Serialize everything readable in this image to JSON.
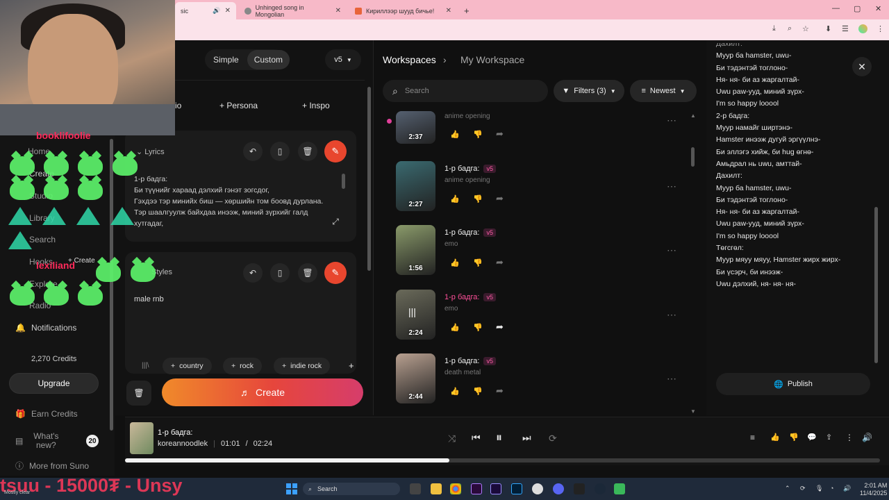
{
  "browser": {
    "tabs": [
      {
        "label": "sic",
        "active": true
      },
      {
        "label": "Unhinged song in Mongolian"
      },
      {
        "label": "Кириллээр шууд бичье!"
      }
    ],
    "window_controls": [
      "—",
      "▢",
      "✕"
    ]
  },
  "overlay": {
    "top_name": "booklifoolie",
    "bottom_name": "lexiliand",
    "create_small": "+ Create",
    "ticker": "tsuu - 15000₮ - Unsy"
  },
  "sidebar": {
    "items": [
      {
        "label": "Home"
      },
      {
        "label": "Create"
      },
      {
        "label": "Studio"
      },
      {
        "label": "Library"
      },
      {
        "label": "Search"
      },
      {
        "label": "Hooks"
      },
      {
        "label": "Explore"
      },
      {
        "label": "Radio"
      }
    ],
    "notifications": "Notifications",
    "credits": "2,270 Credits",
    "upgrade": "Upgrade",
    "earn_credits": "Earn Credits",
    "whats_new": "What's new?",
    "whats_new_count": "20",
    "more_from": "More from Suno"
  },
  "create": {
    "mode_simple": "Simple",
    "mode_custom": "Custom",
    "version": "v5",
    "tabs": [
      "io",
      "Persona",
      "Inspo"
    ],
    "lyrics_label": "Lyrics",
    "lyrics_lines": [
      "1-р бадга:",
      "Би түүнийг хараад дэлхий гэнэт зогсдог,",
      "Гэхдээ тэр минийх биш — хөршийн том боовд дурлана.",
      "Тэр шаалгуулж байхдаа инээж, миний зүрхийг галд",
      "хутгадаг,"
    ],
    "styles_label": "Styles",
    "styles_value": "male rnb",
    "genres": [
      "country",
      "rock",
      "indie rock"
    ],
    "create_button": "Create"
  },
  "workspace": {
    "breadcrumb_root": "Workspaces",
    "breadcrumb_current": "My Workspace",
    "search_placeholder": "Search",
    "filters": "Filters (3)",
    "sort": "Newest",
    "songs": [
      {
        "title": "",
        "tag": "anime opening",
        "duration": "2:37",
        "thumb": "#556070"
      },
      {
        "title": "1-р бадга:",
        "version": "v5",
        "tag": "anime opening",
        "duration": "2:27",
        "thumb": "#3a6a70"
      },
      {
        "title": "1-р бадга:",
        "version": "v5",
        "tag": "emo",
        "duration": "1:56",
        "thumb": "#8a9a6a"
      },
      {
        "title": "1-р бадга:",
        "version": "v5",
        "tag": "emo",
        "duration": "2:24",
        "thumb": "#6a6a5a",
        "playing": true
      },
      {
        "title": "1-р бадга:",
        "version": "v5",
        "tag": "death metal",
        "duration": "2:44",
        "thumb": "#b8a090"
      }
    ]
  },
  "lyrics_panel": {
    "lines": [
      "Дахилт:",
      "Муур ба hamster, uwu-",
      "Би тэдэнтэй тоглоно-",
      "Ня- ня- би аз жаргалтай-",
      "Uwu paw-ууд, миний зүрх-",
      "",
      "I'm so happy looool",
      "",
      "2-р бадга:",
      "Муур намайг ширтэнэ-",
      "Hamster инээж дугуй эргүүлнэ-",
      "Би эллэгэ хийж, би hug өгнө-",
      "Амьдрал нь uwu, амттай-",
      "",
      "Дахилт:",
      "Муур ба hamster, uwu-",
      "Би тэдэнтэй тоглоно-",
      "Ня- ня- би аз жаргалтай-",
      "Uwu paw-ууд, миний зүрх-",
      "",
      "I'm so happy looool",
      "",
      "",
      "Төгсгөл:",
      "Муур мяуу мяуу, Hamster жирх жирх-",
      "Би үсэрч, би инээж-",
      "Uwu дэлхий, ня- ня- ня-"
    ],
    "publish": "Publish"
  },
  "player": {
    "title": "1-р бадга:",
    "artist": "koreannoodlek",
    "current": "01:01",
    "separator": "/",
    "total": "02:24",
    "progress": 0.43
  },
  "taskbar": {
    "search": "Search",
    "time": "2:01 AM",
    "date": "11/4/2025",
    "weather": "Mostly clear"
  }
}
